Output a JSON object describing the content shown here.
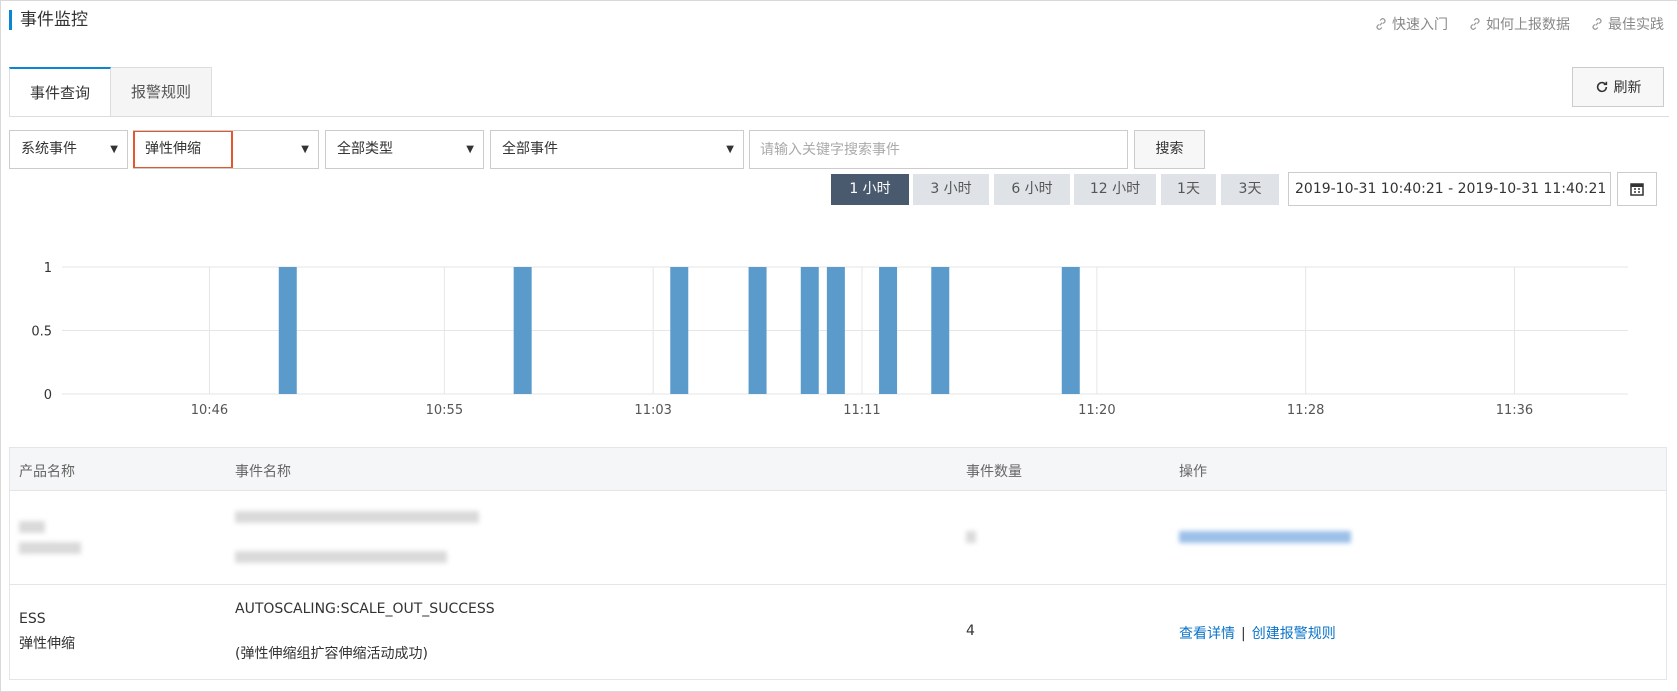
{
  "header": {
    "title": "事件监控"
  },
  "top_links": [
    {
      "label": "快速入门",
      "icon": "link-icon"
    },
    {
      "label": "如何上报数据",
      "icon": "link-icon"
    },
    {
      "label": "最佳实践",
      "icon": "link-icon"
    }
  ],
  "tabs": [
    {
      "label": "事件查询",
      "active": true
    },
    {
      "label": "报警规则",
      "active": false
    }
  ],
  "refresh": {
    "label": "刷新",
    "icon": "refresh-icon"
  },
  "filters": {
    "event_source": "系统事件",
    "product": "弹性伸缩",
    "type": "全部类型",
    "event": "全部事件",
    "search_placeholder": "请输入关键字搜索事件",
    "search_label": "搜索",
    "caret": "▼"
  },
  "time_ranges": [
    {
      "label": "1 小时",
      "active": true
    },
    {
      "label": "3 小时",
      "active": false
    },
    {
      "label": "6 小时",
      "active": false
    },
    {
      "label": "12 小时",
      "active": false
    },
    {
      "label": "1天",
      "active": false
    },
    {
      "label": "3天",
      "active": false
    }
  ],
  "date_range": "2019-10-31 10:40:21 - 2019-10-31 11:40:21",
  "colors": {
    "accent": "#0b86d4",
    "bar": "#5b9bcc",
    "highlight": "#e4572e",
    "link": "#0b74c9"
  },
  "chart_data": {
    "type": "bar",
    "x_start": "10:40:21",
    "x_end": "11:40:21",
    "xticks": [
      "10:46",
      "10:55",
      "11:03",
      "11:11",
      "11:20",
      "11:28",
      "11:36"
    ],
    "yticks": [
      "0",
      "0.5",
      "1"
    ],
    "ylim": [
      0,
      1
    ],
    "bars": [
      {
        "time": "10:49",
        "value": 1
      },
      {
        "time": "10:58",
        "value": 1
      },
      {
        "time": "11:04",
        "value": 1
      },
      {
        "time": "11:07",
        "value": 1
      },
      {
        "time": "11:09",
        "value": 1
      },
      {
        "time": "11:10",
        "value": 1
      },
      {
        "time": "11:12",
        "value": 1
      },
      {
        "time": "11:14",
        "value": 1
      },
      {
        "time": "11:19",
        "value": 1
      }
    ],
    "grid": true
  },
  "table": {
    "columns": [
      "产品名称",
      "事件名称",
      "事件数量",
      "操作"
    ],
    "rows": [
      {
        "product_code": "ESS",
        "product_name": "弹性伸缩",
        "event_name": "AUTOSCALING:SCALE_OUT_SUCCESS",
        "event_desc": "(弹性伸缩组扩容伸缩活动成功)",
        "count": "4",
        "action_detail": "查看详情",
        "action_sep": "|",
        "action_rule": "创建报警规则"
      }
    ]
  }
}
